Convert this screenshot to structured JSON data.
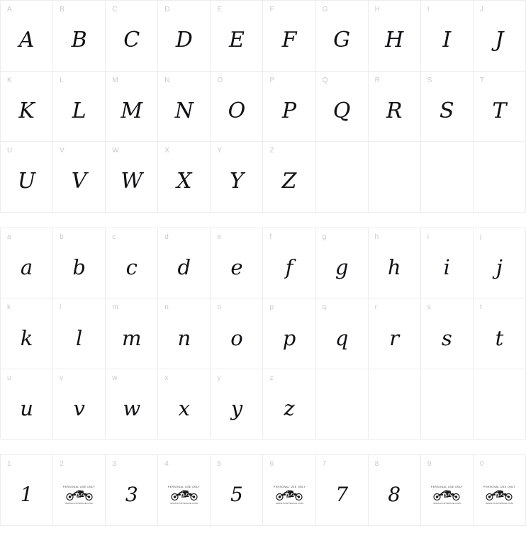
{
  "page": {
    "kind": "font-character-map",
    "background_color": "#ffffff",
    "grid_line_color": "#ececec",
    "label_color": "#c9c9c9",
    "glyph_color": "#111116",
    "columns_per_row": 10
  },
  "sections": [
    {
      "name": "uppercase",
      "rows": [
        [
          {
            "label": "A",
            "glyph": "A",
            "type": "glyph"
          },
          {
            "label": "B",
            "glyph": "B",
            "type": "glyph"
          },
          {
            "label": "C",
            "glyph": "C",
            "type": "glyph"
          },
          {
            "label": "D",
            "glyph": "D",
            "type": "glyph"
          },
          {
            "label": "E",
            "glyph": "E",
            "type": "glyph"
          },
          {
            "label": "F",
            "glyph": "F",
            "type": "glyph"
          },
          {
            "label": "G",
            "glyph": "G",
            "type": "glyph"
          },
          {
            "label": "H",
            "glyph": "H",
            "type": "glyph"
          },
          {
            "label": "I",
            "glyph": "I",
            "type": "glyph"
          },
          {
            "label": "J",
            "glyph": "J",
            "type": "glyph"
          }
        ],
        [
          {
            "label": "K",
            "glyph": "K",
            "type": "glyph"
          },
          {
            "label": "L",
            "glyph": "L",
            "type": "glyph"
          },
          {
            "label": "M",
            "glyph": "M",
            "type": "glyph"
          },
          {
            "label": "N",
            "glyph": "N",
            "type": "glyph"
          },
          {
            "label": "O",
            "glyph": "O",
            "type": "glyph"
          },
          {
            "label": "P",
            "glyph": "P",
            "type": "glyph"
          },
          {
            "label": "Q",
            "glyph": "Q",
            "type": "glyph"
          },
          {
            "label": "R",
            "glyph": "R",
            "type": "glyph"
          },
          {
            "label": "S",
            "glyph": "S",
            "type": "glyph"
          },
          {
            "label": "T",
            "glyph": "T",
            "type": "glyph"
          }
        ],
        [
          {
            "label": "U",
            "glyph": "U",
            "type": "glyph"
          },
          {
            "label": "V",
            "glyph": "V",
            "type": "glyph"
          },
          {
            "label": "W",
            "glyph": "W",
            "type": "glyph"
          },
          {
            "label": "X",
            "glyph": "X",
            "type": "glyph"
          },
          {
            "label": "Y",
            "glyph": "Y",
            "type": "glyph"
          },
          {
            "label": "Z",
            "glyph": "Z",
            "type": "glyph"
          },
          {
            "label": "",
            "glyph": "",
            "type": "empty"
          },
          {
            "label": "",
            "glyph": "",
            "type": "empty"
          },
          {
            "label": "",
            "glyph": "",
            "type": "empty"
          },
          {
            "label": "",
            "glyph": "",
            "type": "empty"
          }
        ]
      ]
    },
    {
      "name": "lowercase",
      "rows": [
        [
          {
            "label": "a",
            "glyph": "a",
            "type": "glyph"
          },
          {
            "label": "b",
            "glyph": "b",
            "type": "glyph"
          },
          {
            "label": "c",
            "glyph": "c",
            "type": "glyph"
          },
          {
            "label": "d",
            "glyph": "d",
            "type": "glyph"
          },
          {
            "label": "e",
            "glyph": "e",
            "type": "glyph"
          },
          {
            "label": "f",
            "glyph": "f",
            "type": "glyph"
          },
          {
            "label": "g",
            "glyph": "g",
            "type": "glyph"
          },
          {
            "label": "h",
            "glyph": "h",
            "type": "glyph"
          },
          {
            "label": "i",
            "glyph": "i",
            "type": "glyph"
          },
          {
            "label": "j",
            "glyph": "j",
            "type": "glyph"
          }
        ],
        [
          {
            "label": "k",
            "glyph": "k",
            "type": "glyph"
          },
          {
            "label": "l",
            "glyph": "l",
            "type": "glyph"
          },
          {
            "label": "m",
            "glyph": "m",
            "type": "glyph"
          },
          {
            "label": "n",
            "glyph": "n",
            "type": "glyph"
          },
          {
            "label": "o",
            "glyph": "o",
            "type": "glyph"
          },
          {
            "label": "p",
            "glyph": "p",
            "type": "glyph"
          },
          {
            "label": "q",
            "glyph": "q",
            "type": "glyph"
          },
          {
            "label": "r",
            "glyph": "r",
            "type": "glyph"
          },
          {
            "label": "s",
            "glyph": "s",
            "type": "glyph"
          },
          {
            "label": "t",
            "glyph": "t",
            "type": "glyph"
          }
        ],
        [
          {
            "label": "u",
            "glyph": "u",
            "type": "glyph"
          },
          {
            "label": "v",
            "glyph": "v",
            "type": "glyph"
          },
          {
            "label": "w",
            "glyph": "w",
            "type": "glyph"
          },
          {
            "label": "x",
            "glyph": "x",
            "type": "glyph"
          },
          {
            "label": "y",
            "glyph": "y",
            "type": "glyph"
          },
          {
            "label": "z",
            "glyph": "z",
            "type": "glyph"
          },
          {
            "label": "",
            "glyph": "",
            "type": "empty"
          },
          {
            "label": "",
            "glyph": "",
            "type": "empty"
          },
          {
            "label": "",
            "glyph": "",
            "type": "empty"
          },
          {
            "label": "",
            "glyph": "",
            "type": "empty"
          }
        ]
      ]
    },
    {
      "name": "digits",
      "rows": [
        [
          {
            "label": "1",
            "glyph": "1",
            "type": "glyph"
          },
          {
            "label": "2",
            "glyph": "",
            "type": "watermark"
          },
          {
            "label": "3",
            "glyph": "3",
            "type": "glyph"
          },
          {
            "label": "4",
            "glyph": "",
            "type": "watermark"
          },
          {
            "label": "5",
            "glyph": "5",
            "type": "glyph"
          },
          {
            "label": "6",
            "glyph": "",
            "type": "watermark"
          },
          {
            "label": "7",
            "glyph": "7",
            "type": "glyph"
          },
          {
            "label": "8",
            "glyph": "8",
            "type": "glyph"
          },
          {
            "label": "9",
            "glyph": "",
            "type": "watermark"
          },
          {
            "label": "0",
            "glyph": "",
            "type": "watermark"
          }
        ]
      ]
    }
  ],
  "watermark": {
    "top_text": "PERSONAL USE ONLY",
    "bottom_text": "WWW.FONTSPACE.COM",
    "art": "motorcycle-logo"
  }
}
